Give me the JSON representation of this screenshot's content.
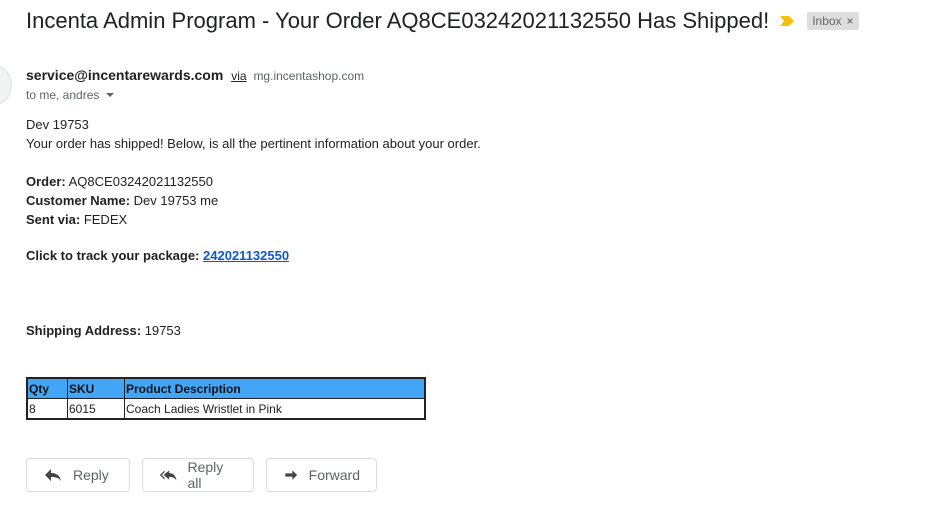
{
  "email": {
    "subject": "Incenta Admin Program - Your Order AQ8CE03242021132550 Has Shipped!",
    "label": "Inbox",
    "label_remove": "×",
    "sender_email": "service@incentarewards.com",
    "via_text": "via",
    "via_domain": "mg.incentashop.com",
    "recipients": "to me, andres"
  },
  "body": {
    "greeting": "Dev 19753",
    "intro": "Your order has shipped! Below, is all the pertinent information about your order.",
    "order_label": "Order:",
    "order_value": "AQ8CE03242021132550",
    "customer_label": "Customer Name:",
    "customer_value": "Dev 19753 me",
    "sent_label": "Sent via:",
    "sent_value": "FEDEX",
    "track_label": "Click to track your package:",
    "track_link": "242021132550",
    "shipping_label": "Shipping Address:",
    "shipping_value": "19753"
  },
  "table": {
    "headers": [
      "Qty",
      "SKU",
      "Product Description"
    ],
    "rows": [
      [
        "8",
        "6015",
        "Coach Ladies Wristlet in Pink"
      ]
    ]
  },
  "actions": {
    "reply": "Reply",
    "reply_all": "Reply all",
    "forward": "Forward"
  },
  "colors": {
    "table_header": "#42a5f5",
    "link": "#1155cc",
    "importance_marker": "#f4c20d"
  },
  "icons": {
    "importance": "importance-marker-icon",
    "reply": "reply-icon",
    "reply_all": "reply-all-icon",
    "forward": "forward-icon",
    "caret": "chevron-down-icon"
  }
}
